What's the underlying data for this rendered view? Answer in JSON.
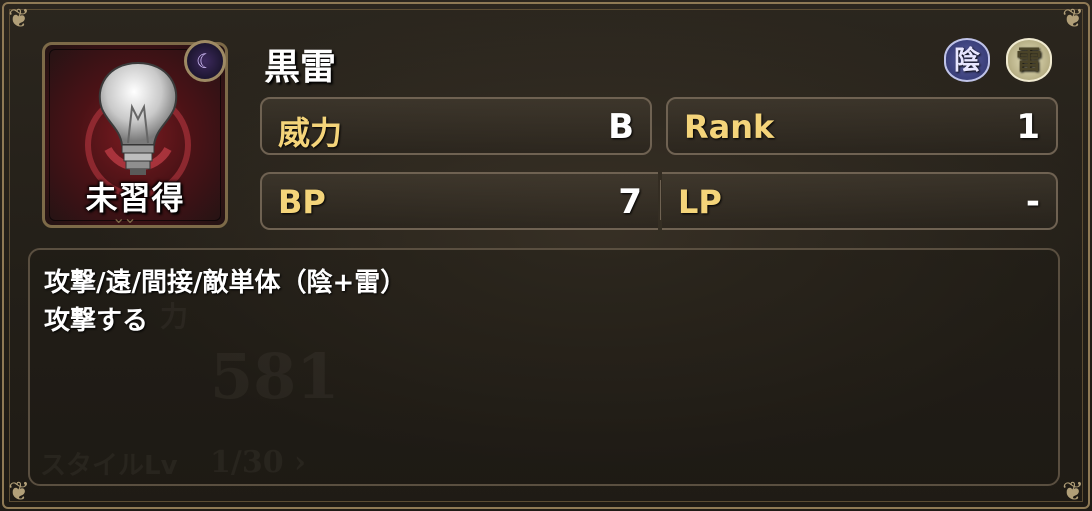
{
  "skill": {
    "name": "黒雷",
    "status": "未習得",
    "attributes": [
      {
        "label": "陰",
        "icon": "yin-attribute-icon",
        "color": "#3a3f7a"
      },
      {
        "label": "雷",
        "icon": "thunder-attribute-icon",
        "color": "#b6ae84"
      }
    ],
    "moon_badge_icon": "crescent-moon-icon",
    "image_icon": "light-bulb-icon"
  },
  "stats": {
    "power": {
      "label": "威力",
      "value": "B"
    },
    "rank": {
      "label": "Rank",
      "value": "1"
    },
    "bp": {
      "label": "BP",
      "value": "7"
    },
    "lp": {
      "label": "LP",
      "value": "-"
    }
  },
  "description": {
    "line1": "攻撃/遠/間接/敵単体（陰+雷）",
    "line2": "攻撃する"
  },
  "background": {
    "ghost_power": "581",
    "ghost_style_label": "スタイルLv",
    "ghost_style_value": "1/30 ›",
    "ghost_power_label": "力"
  },
  "colors": {
    "label_gold": "#f4d47a",
    "frame": "#8f7a55",
    "panel_bg": "#2b261e"
  }
}
